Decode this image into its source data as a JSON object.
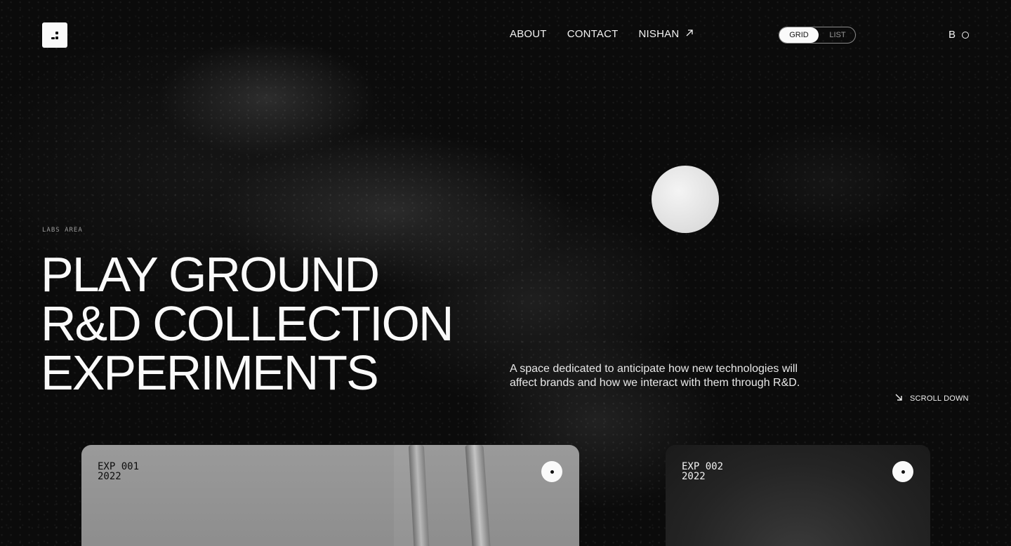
{
  "header": {
    "nav": [
      {
        "label": "ABOUT"
      },
      {
        "label": "CONTACT"
      },
      {
        "label": "NISHAN"
      }
    ],
    "view_toggle": {
      "grid_label": "GRID",
      "list_label": "LIST",
      "selected": "GRID"
    },
    "brand_letter": "B"
  },
  "hero": {
    "eyebrow": "LABS AREA",
    "headline": [
      "PLAY GROUND",
      "R&D COLLECTION",
      "EXPERIMENTS"
    ],
    "tagline": "A space dedicated to anticipate how new technologies will affect brands and how we interact with them through R&D.",
    "scroll_label": "SCROLL DOWN"
  },
  "cards": [
    {
      "id": "EXP 001",
      "year": "2022"
    },
    {
      "id": "EXP 002",
      "year": "2022"
    }
  ]
}
